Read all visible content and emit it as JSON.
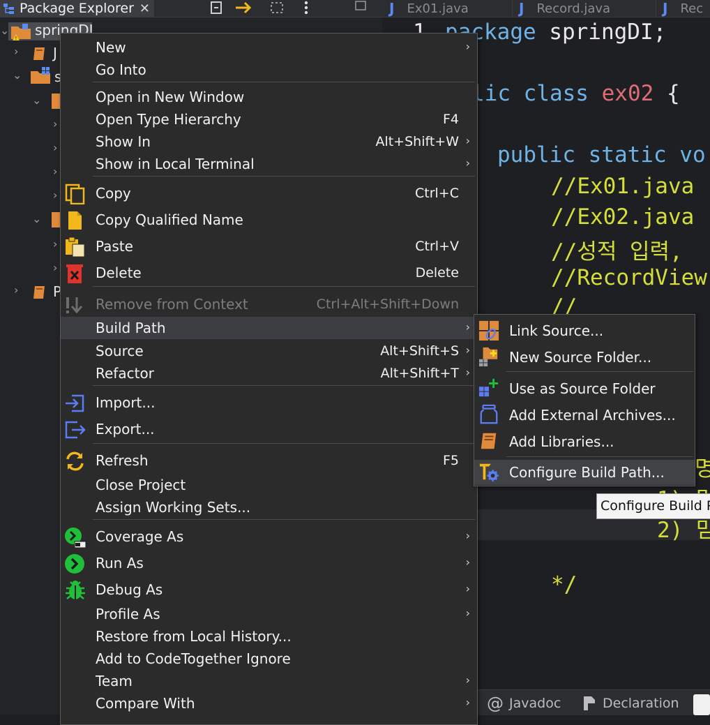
{
  "explorer": {
    "title": "Package Explorer",
    "close": "✕",
    "project_label": "springDI",
    "rows": [
      "J",
      "s",
      "P"
    ]
  },
  "editor": {
    "tabs": [
      "Ex01.java",
      "Record.java",
      "Rec"
    ],
    "lines": {
      "l1_num": "1",
      "l1_kw": "package",
      "l1_rest": " springDI;",
      "l2_kw": "lic class",
      "l2_cls": " ex02",
      "l2_rest": " {",
      "l3_kw": "public static vo",
      "c1": "//Ex01.java",
      "c2": "//Ex02.java",
      "c3": "//성적 입력,",
      "c4": "//RecordView",
      "c5": "//",
      "c6": "명",
      "c7": "1) 맏",
      "c8": "2) 맏",
      "c9": "*/"
    },
    "bottom_tabs": [
      "Javadoc",
      "Declaration"
    ]
  },
  "context_menu": {
    "items": [
      {
        "label": "New",
        "shortcut": "",
        "submenu": true
      },
      {
        "label": "Go Into",
        "shortcut": "",
        "submenu": false
      },
      {
        "label": "Open in New Window",
        "shortcut": "",
        "submenu": false
      },
      {
        "label": "Open Type Hierarchy",
        "shortcut": "F4",
        "submenu": false
      },
      {
        "label": "Show In",
        "shortcut": "Alt+Shift+W",
        "submenu": true
      },
      {
        "label": "Show in Local Terminal",
        "shortcut": "",
        "submenu": true
      },
      {
        "label": "Copy",
        "shortcut": "Ctrl+C",
        "submenu": false
      },
      {
        "label": "Copy Qualified Name",
        "shortcut": "",
        "submenu": false
      },
      {
        "label": "Paste",
        "shortcut": "Ctrl+V",
        "submenu": false
      },
      {
        "label": "Delete",
        "shortcut": "Delete",
        "submenu": false
      },
      {
        "label": "Remove from Context",
        "shortcut": "Ctrl+Alt+Shift+Down",
        "submenu": false
      },
      {
        "label": "Build Path",
        "shortcut": "",
        "submenu": true
      },
      {
        "label": "Source",
        "shortcut": "Alt+Shift+S",
        "submenu": true
      },
      {
        "label": "Refactor",
        "shortcut": "Alt+Shift+T",
        "submenu": true
      },
      {
        "label": "Import...",
        "shortcut": "",
        "submenu": false
      },
      {
        "label": "Export...",
        "shortcut": "",
        "submenu": false
      },
      {
        "label": "Refresh",
        "shortcut": "F5",
        "submenu": false
      },
      {
        "label": "Close Project",
        "shortcut": "",
        "submenu": false
      },
      {
        "label": "Assign Working Sets...",
        "shortcut": "",
        "submenu": false
      },
      {
        "label": "Coverage As",
        "shortcut": "",
        "submenu": true
      },
      {
        "label": "Run As",
        "shortcut": "",
        "submenu": true
      },
      {
        "label": "Debug As",
        "shortcut": "",
        "submenu": true
      },
      {
        "label": "Profile As",
        "shortcut": "",
        "submenu": true
      },
      {
        "label": "Restore from Local History...",
        "shortcut": "",
        "submenu": false
      },
      {
        "label": "Add to CodeTogether Ignore",
        "shortcut": "",
        "submenu": false
      },
      {
        "label": "Team",
        "shortcut": "",
        "submenu": true
      },
      {
        "label": "Compare With",
        "shortcut": "",
        "submenu": true
      }
    ]
  },
  "build_path_submenu": {
    "items": [
      {
        "label": "Link Source..."
      },
      {
        "label": "New Source Folder..."
      },
      {
        "label": "Use as Source Folder"
      },
      {
        "label": "Add External Archives..."
      },
      {
        "label": "Add Libraries..."
      },
      {
        "label": "Configure Build Path..."
      }
    ]
  },
  "tooltip": "Configure Build Path",
  "arrow_glyph": "›"
}
